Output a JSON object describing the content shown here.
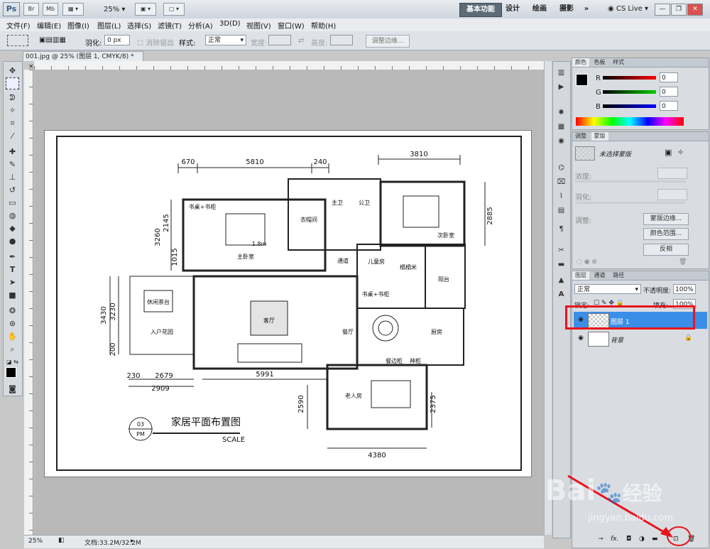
{
  "appbar": {
    "logo": "Ps",
    "br": "Br",
    "mb": "Mb",
    "zoom": "25%",
    "workspaces": [
      "基本功能",
      "设计",
      "绘画",
      "摄影"
    ],
    "more": "»",
    "cslive": "CS Live",
    "win_min": "—",
    "win_restore": "❐",
    "win_close": "✕"
  },
  "menu": [
    "文件(F)",
    "编辑(E)",
    "图像(I)",
    "图层(L)",
    "选择(S)",
    "滤镜(T)",
    "分析(A)",
    "3D(D)",
    "视图(V)",
    "窗口(W)",
    "帮助(H)"
  ],
  "options": {
    "feather_label": "羽化:",
    "feather_value": "0 px",
    "antialias": "消除锯齿",
    "style_label": "样式:",
    "style_value": "正常",
    "width_label": "宽度:",
    "height_label": "高度:",
    "refine_edge": "调整边缘..."
  },
  "doc": {
    "tab_title": "001.jpg @ 25% (图层 1, CMYK/8) *",
    "close": "×",
    "zoom": "25%",
    "doc_size": "文档:33.2M/32.2M"
  },
  "color_panel": {
    "tabs": [
      "颜色",
      "色板",
      "样式"
    ],
    "r_label": "R",
    "g_label": "G",
    "b_label": "B",
    "r": "0",
    "g": "0",
    "b": "0"
  },
  "adjust_panel": {
    "tabs": [
      "调整",
      "蒙版"
    ],
    "no_mask": "未选择蒙版",
    "density": "浓度:",
    "feather": "羽化:",
    "refine": "调整:",
    "mask_edge": "蒙版边缘...",
    "color_range": "颜色范围...",
    "invert": "反相"
  },
  "layers_panel": {
    "tabs": [
      "图层",
      "通道",
      "路径"
    ],
    "blend_mode": "正常",
    "opacity_label": "不透明度:",
    "opacity": "100%",
    "lock_label": "锁定:",
    "fill_label": "填充:",
    "fill": "100%",
    "layers": [
      {
        "name": "图层 1",
        "selected": true
      },
      {
        "name": "背景",
        "selected": false
      }
    ],
    "footer_icons": [
      "link-icon",
      "fx-icon",
      "mask-icon",
      "adjustment-icon",
      "folder-icon",
      "new-layer-icon",
      "trash-icon"
    ],
    "fx": "fx."
  },
  "plan": {
    "dims_top": [
      "670",
      "5810",
      "240",
      "3810"
    ],
    "dims_left": [
      "3260",
      "2145",
      "1015",
      "3430",
      "3230",
      "200"
    ],
    "dims_bottom": [
      "230",
      "2679",
      "2909",
      "5991",
      "2590",
      "2375",
      "4380"
    ],
    "dim_right": "2885",
    "rooms": [
      "主卫",
      "公卫",
      "主卧室",
      "衣帽间",
      "次卧室",
      "通道",
      "儿童房",
      "榻榻米",
      "阳台",
      "休闲茶台",
      "入户花园",
      "客厅",
      "餐厅",
      "厨房",
      "书桌+书柜",
      "餐边柜",
      "神柜",
      "老人房",
      "书桌+书柜"
    ],
    "bed": "1.8m",
    "badge_num": "03",
    "badge_pm": "PM",
    "title": "家居平面布置图",
    "scale": "SCALE"
  },
  "watermark": {
    "brand": "Bai",
    "du": "经验",
    "url": "jingyan.baidu.com"
  },
  "colors": {
    "accent_red": "#e8141c",
    "selected_layer": "#3b8ee8"
  }
}
